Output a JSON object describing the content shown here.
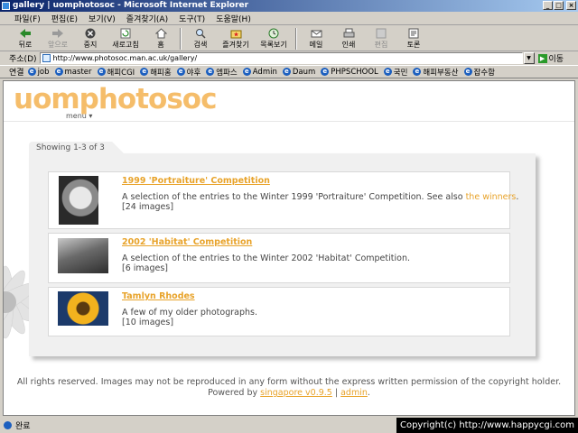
{
  "window": {
    "title": "gallery | uomphotosoc - Microsoft Internet Explorer"
  },
  "menubar": {
    "items": [
      "파일(F)",
      "편집(E)",
      "보기(V)",
      "즐겨찾기(A)",
      "도구(T)",
      "도움말(H)"
    ]
  },
  "toolbar": {
    "back": "뒤로",
    "forward": "앞으로",
    "stop": "중지",
    "refresh": "새로고침",
    "home": "홈",
    "search": "검색",
    "favorites": "즐겨찾기",
    "history": "목록보기",
    "mail": "메일",
    "print": "인쇄",
    "edit": "편집",
    "discuss": "토론"
  },
  "address": {
    "label": "주소(D)",
    "url": "http://www.photosoc.man.ac.uk/gallery/",
    "go": "이동"
  },
  "links": {
    "label": "연결",
    "items": [
      "job",
      "master",
      "해피CGI",
      "해피홈",
      "야후",
      "엠파스",
      "Admin",
      "Daum",
      "PHPSCHOOL",
      "국민",
      "해피부동산",
      "잡수함"
    ]
  },
  "site": {
    "logo": "uomphotosoc",
    "menu": "menu ▾",
    "showing": "Showing 1-3 of 3",
    "entries": [
      {
        "title": "1999 'Portraiture' Competition",
        "desc": "A selection of the entries to the Winter 1999 'Portraiture' Competition. See also",
        "desc_link": "the winners",
        "desc_end": ".",
        "count": "[24 images]"
      },
      {
        "title": "2002 'Habitat' Competition",
        "desc": "A selection of the entries to the Winter 2002 'Habitat' Competition.",
        "count": "[6 images]"
      },
      {
        "title": "Tamlyn Rhodes",
        "desc": "A few of my older photographs.",
        "count": "[10 images]"
      }
    ],
    "footer_line1": "All rights reserved. Images may not be reproduced in any form without the express written permission of the copyright holder.",
    "footer_powered": "Powered by",
    "footer_singapore": "singapore v0.9.5",
    "footer_sep": "|",
    "footer_admin": "admin",
    "footer_end": "."
  },
  "status": {
    "text": "완료",
    "copyright": "Copyright(c) http://www.happycgi.com"
  }
}
